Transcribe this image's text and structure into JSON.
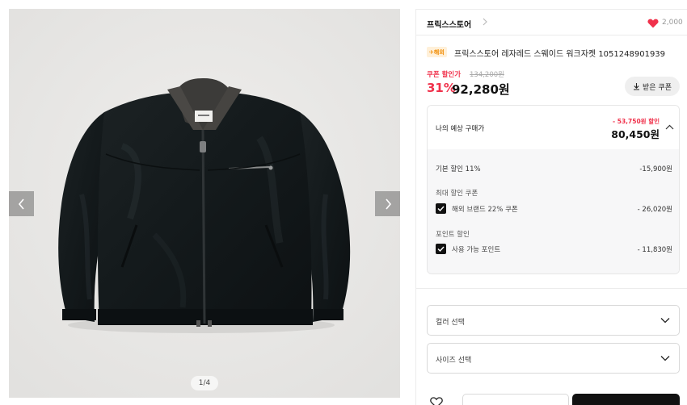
{
  "gallery": {
    "counter": "1/4"
  },
  "store": {
    "name": "프릭스스토어",
    "likes": "2,000"
  },
  "product": {
    "badge": "해외",
    "title": "프릭스스토어 레자레드 스웨이드 워크자켓 1051248901939"
  },
  "price": {
    "coupon_label": "쿠폰 할인가",
    "original": "134,200원",
    "discount_rate": "31%",
    "sale": "92,280원",
    "coupon_button": "받은 쿠폰"
  },
  "estimate": {
    "label": "나의 예상 구매가",
    "savings": "- 53,750원 할인",
    "price": "80,450원",
    "rows": [
      {
        "label": "기본 할인 11%",
        "value": "-15,900원"
      },
      {
        "label": "최대 할인 쿠폰"
      },
      {
        "label": "해외 브랜드 22% 쿠폰",
        "value": "- 26,020원",
        "checked": true
      },
      {
        "label": "포인트 할인"
      },
      {
        "label": "사용 가능 포인트",
        "value": "- 11,830원",
        "checked": true
      }
    ]
  },
  "options": {
    "color": "컬러 선택",
    "size": "사이즈 선택"
  },
  "colors": {
    "accent": "#f0314b",
    "badge_bg": "#fff0d9",
    "badge_text": "#f08a00",
    "primary_button": "#111111"
  },
  "icons": [
    "chevron-left-icon",
    "chevron-right-icon",
    "chevron-right-small-icon",
    "heart-filled-icon",
    "download-icon",
    "chevron-up-icon",
    "check-icon",
    "chevron-down-icon",
    "heart-outline-icon"
  ]
}
